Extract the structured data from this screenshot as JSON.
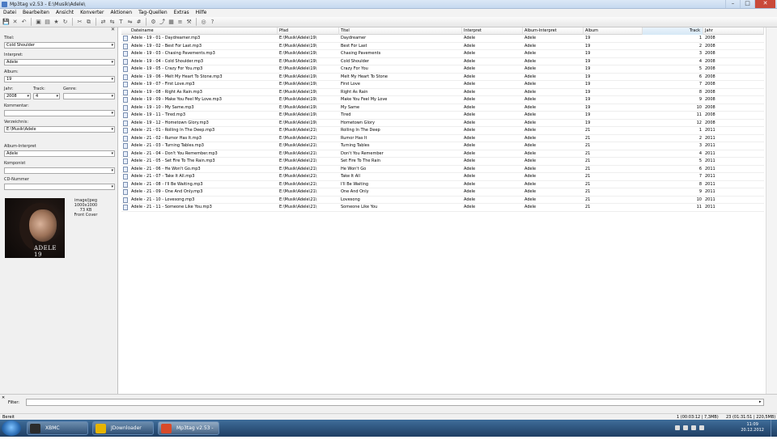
{
  "window": {
    "title": "Mp3tag v2.53  -  E:\\Musik\\Adele\\"
  },
  "menu": [
    "Datei",
    "Bearbeiten",
    "Ansicht",
    "Konverter",
    "Aktionen",
    "Tag-Quellen",
    "Extras",
    "Hilfe"
  ],
  "toolbar_icons": [
    "save-icon",
    "remove-icon",
    "undo-icon",
    "open-folder-icon",
    "add-folder-icon",
    "favorites-icon",
    "refresh-icon",
    "cut-icon",
    "copy-icon",
    "tag-to-filename-icon",
    "filename-to-tag-icon",
    "text-to-tag-icon",
    "tag-to-tag-icon",
    "auto-numbering-icon",
    "actions-icon",
    "export-icon",
    "playlist-icon",
    "extended-tags-icon",
    "options-icon",
    "web-source-icon",
    "help-icon"
  ],
  "leftpanel": {
    "title_label": "Titel:",
    "title_value": "Cold Shoulder",
    "artist_label": "Interpret:",
    "artist_value": "Adele",
    "album_label": "Album:",
    "album_value": "19",
    "year_label": "Jahr:",
    "year_value": "2008",
    "track_label": "Track:",
    "track_value": "4",
    "genre_label": "Genre:",
    "genre_value": "",
    "comment_label": "Kommentar:",
    "comment_value": "",
    "dir_label": "Verzeichnis:",
    "dir_value": "E:\\Musik\\Adele",
    "albumartist_label": "Album-Interpret",
    "albumartist_value": "Adele",
    "composer_label": "Komponist",
    "composer_value": "",
    "cd_label": "CD-Nummer",
    "cd_value": "",
    "cover": {
      "format": "image/jpeg",
      "dims": "1000x1000",
      "size": "73 KB",
      "type": "Front Cover",
      "logo": "ADELE 19"
    }
  },
  "columns": [
    "Dateiname",
    "Pfad",
    "Titel",
    "Interpret",
    "Album-Interpret",
    "Album",
    "Track",
    "Jahr"
  ],
  "rows": [
    [
      "Adele - 19 - 01 - Daydreamer.mp3",
      "E:\\Musik\\Adele\\19\\",
      "Daydreamer",
      "Adele",
      "Adele",
      "19",
      "1",
      "2008"
    ],
    [
      "Adele - 19 - 02 - Best For Last.mp3",
      "E:\\Musik\\Adele\\19\\",
      "Best For Last",
      "Adele",
      "Adele",
      "19",
      "2",
      "2008"
    ],
    [
      "Adele - 19 - 03 - Chasing Pavements.mp3",
      "E:\\Musik\\Adele\\19\\",
      "Chasing Pavements",
      "Adele",
      "Adele",
      "19",
      "3",
      "2008"
    ],
    [
      "Adele - 19 - 04 - Cold Shoulder.mp3",
      "E:\\Musik\\Adele\\19\\",
      "Cold Shoulder",
      "Adele",
      "Adele",
      "19",
      "4",
      "2008"
    ],
    [
      "Adele - 19 - 05 - Crazy For You.mp3",
      "E:\\Musik\\Adele\\19\\",
      "Crazy For You",
      "Adele",
      "Adele",
      "19",
      "5",
      "2008"
    ],
    [
      "Adele - 19 - 06 - Melt My Heart To Stone.mp3",
      "E:\\Musik\\Adele\\19\\",
      "Melt My Heart To Stone",
      "Adele",
      "Adele",
      "19",
      "6",
      "2008"
    ],
    [
      "Adele - 19 - 07 - First Love.mp3",
      "E:\\Musik\\Adele\\19\\",
      "First Love",
      "Adele",
      "Adele",
      "19",
      "7",
      "2008"
    ],
    [
      "Adele - 19 - 08 - Right As Rain.mp3",
      "E:\\Musik\\Adele\\19\\",
      "Right As Rain",
      "Adele",
      "Adele",
      "19",
      "8",
      "2008"
    ],
    [
      "Adele - 19 - 09 - Make You Feel My Love.mp3",
      "E:\\Musik\\Adele\\19\\",
      "Make You Feel My Love",
      "Adele",
      "Adele",
      "19",
      "9",
      "2008"
    ],
    [
      "Adele - 19 - 10 - My Same.mp3",
      "E:\\Musik\\Adele\\19\\",
      "My Same",
      "Adele",
      "Adele",
      "19",
      "10",
      "2008"
    ],
    [
      "Adele - 19 - 11 - Tired.mp3",
      "E:\\Musik\\Adele\\19\\",
      "Tired",
      "Adele",
      "Adele",
      "19",
      "11",
      "2008"
    ],
    [
      "Adele - 19 - 12 - Hometown Glory.mp3",
      "E:\\Musik\\Adele\\19\\",
      "Hometown Glory",
      "Adele",
      "Adele",
      "19",
      "12",
      "2008"
    ],
    [
      "Adele - 21 - 01 - Rolling In The Deep.mp3",
      "E:\\Musik\\Adele\\21\\",
      "Rolling In The Deep",
      "Adele",
      "Adele",
      "21",
      "1",
      "2011"
    ],
    [
      "Adele - 21 - 02 - Rumor Has It.mp3",
      "E:\\Musik\\Adele\\21\\",
      "Rumor Has It",
      "Adele",
      "Adele",
      "21",
      "2",
      "2011"
    ],
    [
      "Adele - 21 - 03 - Turning Tables.mp3",
      "E:\\Musik\\Adele\\21\\",
      "Turning Tables",
      "Adele",
      "Adele",
      "21",
      "3",
      "2011"
    ],
    [
      "Adele - 21 - 04 - Don't You Remember.mp3",
      "E:\\Musik\\Adele\\21\\",
      "Don't You Remember",
      "Adele",
      "Adele",
      "21",
      "4",
      "2011"
    ],
    [
      "Adele - 21 - 05 - Set Fire To The Rain.mp3",
      "E:\\Musik\\Adele\\21\\",
      "Set Fire To The Rain",
      "Adele",
      "Adele",
      "21",
      "5",
      "2011"
    ],
    [
      "Adele - 21 - 06 - He Won't Go.mp3",
      "E:\\Musik\\Adele\\21\\",
      "He Won't Go",
      "Adele",
      "Adele",
      "21",
      "6",
      "2011"
    ],
    [
      "Adele - 21 - 07 - Take It All.mp3",
      "E:\\Musik\\Adele\\21\\",
      "Take It All",
      "Adele",
      "Adele",
      "21",
      "7",
      "2011"
    ],
    [
      "Adele - 21 - 08 - I'll Be Waiting.mp3",
      "E:\\Musik\\Adele\\21\\",
      "I'll Be Waiting",
      "Adele",
      "Adele",
      "21",
      "8",
      "2011"
    ],
    [
      "Adele - 21 - 09 - One And Only.mp3",
      "E:\\Musik\\Adele\\21\\",
      "One And Only",
      "Adele",
      "Adele",
      "21",
      "9",
      "2011"
    ],
    [
      "Adele - 21 - 10 - Lovesong.mp3",
      "E:\\Musik\\Adele\\21\\",
      "Lovesong",
      "Adele",
      "Adele",
      "21",
      "10",
      "2011"
    ],
    [
      "Adele - 21 - 11 - Someone Like You.mp3",
      "E:\\Musik\\Adele\\21\\",
      "Someone Like You",
      "Adele",
      "Adele",
      "21",
      "11",
      "2011"
    ]
  ],
  "filter": {
    "label": "Filter:",
    "value": ""
  },
  "status": {
    "left": "Bereit",
    "selected": "1 (00:03:12 | 7,3MB)",
    "total": "23 (01:31:51 | 220,5MB)"
  },
  "taskbar": {
    "tasks": [
      {
        "label": "XBMC",
        "color": "#2b2b2b"
      },
      {
        "label": "JDownloader",
        "color": "#e6b400"
      },
      {
        "label": "Mp3tag v2.53 - E...",
        "color": "#d84a2a"
      }
    ],
    "time": "11:09",
    "date": "20.12.2012"
  }
}
